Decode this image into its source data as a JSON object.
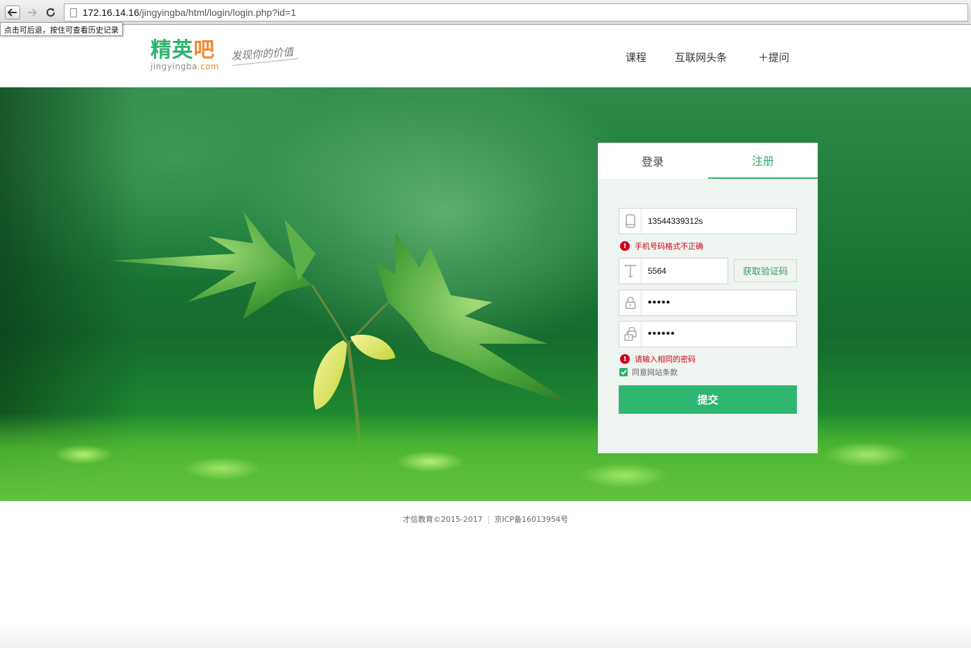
{
  "browser": {
    "url_host": "172.16.14.16",
    "url_path": "/jingyingba/html/login/login.php?id=1",
    "back_tooltip": "点击可后退，按住可查看历史记录",
    "icons": [
      "back-arrow-icon",
      "forward-arrow-icon",
      "reload-icon",
      "page-icon"
    ]
  },
  "header": {
    "logo": {
      "cn_part1": "精英",
      "cn_part2": "吧",
      "en_part1": "jingyingba",
      "en_part2": ".com"
    },
    "slogan": "发现你的价值",
    "nav": {
      "course": "课程",
      "news": "互联网头条",
      "ask": "＋提问"
    }
  },
  "form": {
    "tabs": {
      "login": "登录",
      "register": "注册",
      "active": "register"
    },
    "phone": {
      "value": "13544339312s",
      "icon": "phone-icon",
      "error": "手机号码格式不正确"
    },
    "code": {
      "value": "5564",
      "icon": "text-icon",
      "button": "获取验证码"
    },
    "password": {
      "value": "•••••",
      "icon": "lock-icon"
    },
    "password_confirm": {
      "value": "••••••",
      "icon": "lock-double-icon",
      "error": "请输入相同的密码"
    },
    "agree": {
      "label": "同意网站条款",
      "checked": true
    },
    "submit": "提交"
  },
  "footer": {
    "copyright": "才信教育©2015-2017",
    "icp": "京ICP备16013954号"
  },
  "colors": {
    "accent": "#2eb572",
    "error": "#d0021b",
    "logo_green": "#2fb36f",
    "logo_orange": "#f08b32"
  }
}
